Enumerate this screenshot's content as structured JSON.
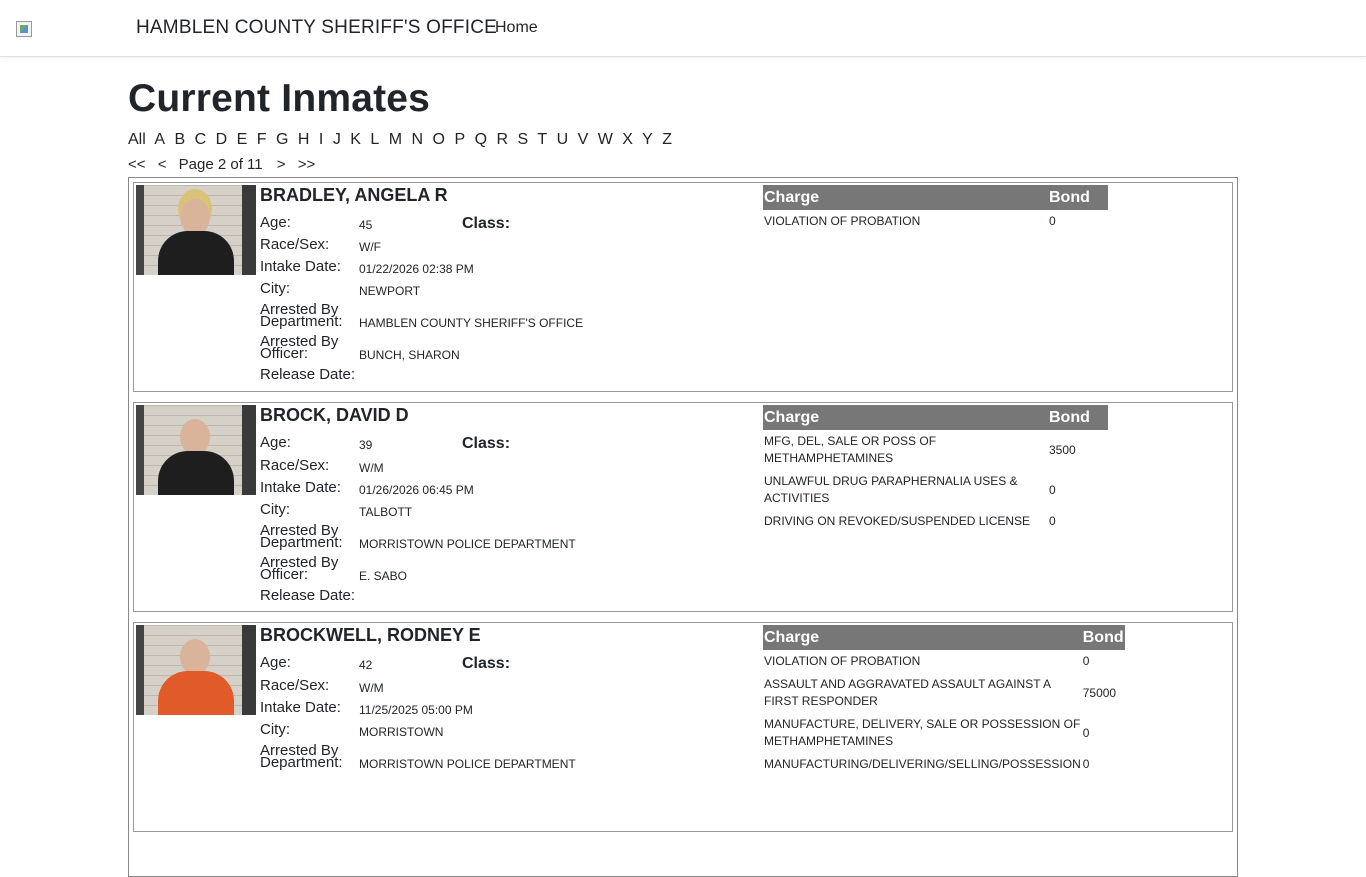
{
  "nav": {
    "brand": "HAMBLEN COUNTY SHERIFF'S OFFICE",
    "home": "Home"
  },
  "page": {
    "title": "Current Inmates"
  },
  "alphabet": [
    "All",
    "A",
    "B",
    "C",
    "D",
    "E",
    "F",
    "G",
    "H",
    "I",
    "J",
    "K",
    "L",
    "M",
    "N",
    "O",
    "P",
    "Q",
    "R",
    "S",
    "T",
    "U",
    "V",
    "W",
    "X",
    "Y",
    "Z"
  ],
  "pager": {
    "first": "<<",
    "prev": "<",
    "text": "Page 2 of 11",
    "next": ">",
    "last": ">>"
  },
  "labels": {
    "age": "Age:",
    "class": "Class:",
    "race_sex": "Race/Sex:",
    "intake_date": "Intake Date:",
    "city": "City:",
    "arrested_dept_1": "Arrested By",
    "arrested_dept_2": "Department:",
    "arrested_officer_1": "Arrested By",
    "arrested_officer_2": "Officer:",
    "release_date": "Release Date:",
    "charge": "Charge",
    "bond": "Bond"
  },
  "inmates": [
    {
      "name": "BRADLEY, ANGELA R",
      "age": "45",
      "class": "",
      "race_sex": "W/F",
      "intake_date": "01/22/2026 02:38 PM",
      "city": "NEWPORT",
      "department": "HAMBLEN COUNTY SHERIFF'S OFFICE",
      "officer": "BUNCH, SHARON",
      "release_date": "",
      "charges": [
        {
          "charge": "VIOLATION OF PROBATION",
          "bond": "0"
        }
      ]
    },
    {
      "name": "BROCK, DAVID D",
      "age": "39",
      "class": "",
      "race_sex": "W/M",
      "intake_date": "01/26/2026 06:45 PM",
      "city": "TALBOTT",
      "department": "MORRISTOWN POLICE DEPARTMENT",
      "officer": "E. SABO",
      "release_date": "",
      "charges": [
        {
          "charge": "MFG, DEL, SALE OR POSS OF METHAMPHETAMINES",
          "bond": "3500"
        },
        {
          "charge": "UNLAWFUL DRUG PARAPHERNALIA USES & ACTIVITIES",
          "bond": "0"
        },
        {
          "charge": "DRIVING ON REVOKED/SUSPENDED LICENSE",
          "bond": "0"
        }
      ]
    },
    {
      "name": "BROCKWELL, RODNEY E",
      "age": "42",
      "class": "",
      "race_sex": "W/M",
      "intake_date": "11/25/2025 05:00 PM",
      "city": "MORRISTOWN",
      "department": "MORRISTOWN POLICE DEPARTMENT",
      "officer": "",
      "release_date": "",
      "charges": [
        {
          "charge": "VIOLATION OF PROBATION",
          "bond": "0"
        },
        {
          "charge": "ASSAULT AND AGGRAVATED ASSAULT AGAINST A FIRST RESPONDER",
          "bond": "75000"
        },
        {
          "charge": "MANUFACTURE, DELIVERY, SALE OR POSSESSION OF METHAMPHETAMINES",
          "bond": "0"
        },
        {
          "charge": "MANUFACTURING/DELIVERING/SELLING/POSSESSION",
          "bond": "0"
        }
      ]
    }
  ]
}
